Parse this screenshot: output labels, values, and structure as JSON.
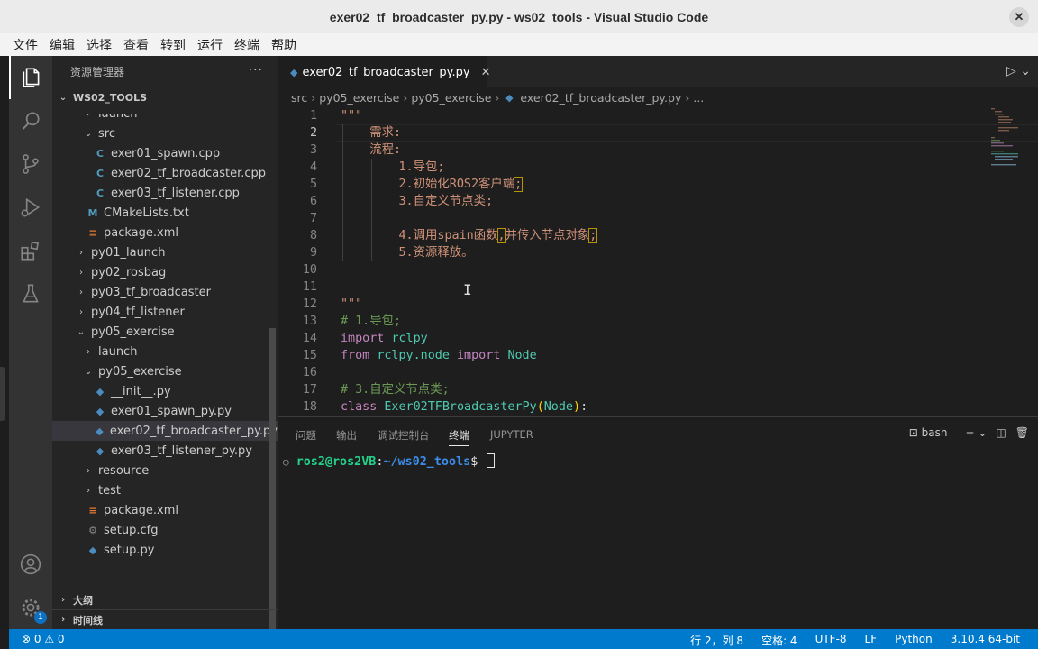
{
  "window": {
    "title": "exer02_tf_broadcaster_py.py - ws02_tools - Visual Studio Code",
    "close_glyph": "✕"
  },
  "menu": [
    "文件",
    "编辑",
    "选择",
    "查看",
    "转到",
    "运行",
    "终端",
    "帮助"
  ],
  "activity_bar": {
    "icons": [
      "files-icon",
      "search-icon",
      "source-control-icon",
      "run-debug-icon",
      "extensions-icon",
      "testing-icon",
      "account-icon",
      "settings-gear-icon"
    ],
    "settings_badge": "1"
  },
  "explorer": {
    "title": "资源管理器",
    "more": "···",
    "root": "WS02_TOOLS",
    "items": [
      {
        "label": "launch",
        "type": "folder",
        "expanded": false,
        "depth": 1
      },
      {
        "label": "src",
        "type": "folder",
        "expanded": true,
        "depth": 1
      },
      {
        "label": "exer01_spawn.cpp",
        "type": "cpp",
        "depth": 2
      },
      {
        "label": "exer02_tf_broadcaster.cpp",
        "type": "cpp",
        "depth": 2
      },
      {
        "label": "exer03_tf_listener.cpp",
        "type": "cpp",
        "depth": 2
      },
      {
        "label": "CMakeLists.txt",
        "type": "cmake",
        "depth": 1
      },
      {
        "label": "package.xml",
        "type": "xml",
        "depth": 1
      },
      {
        "label": "py01_launch",
        "type": "folder",
        "expanded": false,
        "depth": 0
      },
      {
        "label": "py02_rosbag",
        "type": "folder",
        "expanded": false,
        "depth": 0
      },
      {
        "label": "py03_tf_broadcaster",
        "type": "folder",
        "expanded": false,
        "depth": 0
      },
      {
        "label": "py04_tf_listener",
        "type": "folder",
        "expanded": false,
        "depth": 0
      },
      {
        "label": "py05_exercise",
        "type": "folder",
        "expanded": true,
        "depth": 0
      },
      {
        "label": "launch",
        "type": "folder",
        "expanded": false,
        "depth": 1
      },
      {
        "label": "py05_exercise",
        "type": "folder",
        "expanded": true,
        "depth": 1
      },
      {
        "label": "__init__.py",
        "type": "py",
        "depth": 2
      },
      {
        "label": "exer01_spawn_py.py",
        "type": "py",
        "depth": 2
      },
      {
        "label": "exer02_tf_broadcaster_py.py",
        "type": "py",
        "depth": 2,
        "selected": true
      },
      {
        "label": "exer03_tf_listener_py.py",
        "type": "py",
        "depth": 2
      },
      {
        "label": "resource",
        "type": "folder",
        "expanded": false,
        "depth": 1
      },
      {
        "label": "test",
        "type": "folder",
        "expanded": false,
        "depth": 1
      },
      {
        "label": "package.xml",
        "type": "xml",
        "depth": 1
      },
      {
        "label": "setup.cfg",
        "type": "cfg",
        "depth": 1
      },
      {
        "label": "setup.py",
        "type": "py",
        "depth": 1
      }
    ],
    "outline": "大纲",
    "timeline": "时间线"
  },
  "editor": {
    "tab": {
      "label": "exer02_tf_broadcaster_py.py",
      "close": "✕"
    },
    "breadcrumb": [
      "src",
      "py05_exercise",
      "py05_exercise",
      "exer02_tf_broadcaster_py.py",
      "..."
    ],
    "lines": [
      [
        {
          "t": "\"\"\"",
          "c": "s"
        }
      ],
      [
        {
          "t": "    需求:",
          "c": "s"
        }
      ],
      [
        {
          "t": "    流程:",
          "c": "s"
        }
      ],
      [
        {
          "t": "        1.导包;",
          "c": "s"
        }
      ],
      [
        {
          "t": "        2.初始化ROS2客户端",
          "c": "s"
        },
        {
          "t": ";",
          "c": "s hl"
        }
      ],
      [
        {
          "t": "        3.自定义节点类;",
          "c": "s"
        }
      ],
      [
        {
          "t": "",
          "c": "s"
        }
      ],
      [
        {
          "t": "        4.调用spain函数",
          "c": "s"
        },
        {
          "t": ",",
          "c": "s hl"
        },
        {
          "t": "并传入节点对象",
          "c": "s"
        },
        {
          "t": ";",
          "c": "s hl"
        }
      ],
      [
        {
          "t": "        5.资源释放。",
          "c": "s"
        }
      ],
      [
        {
          "t": "",
          "c": "s"
        }
      ],
      [
        {
          "t": "",
          "c": "s"
        }
      ],
      [
        {
          "t": "\"\"\"",
          "c": "s"
        }
      ],
      [
        {
          "t": "# 1.导包;",
          "c": "c"
        }
      ],
      [
        {
          "t": "import",
          "c": "k"
        },
        {
          "t": " ",
          "c": ""
        },
        {
          "t": "rclpy",
          "c": "t"
        }
      ],
      [
        {
          "t": "from",
          "c": "k"
        },
        {
          "t": " ",
          "c": ""
        },
        {
          "t": "rclpy.node",
          "c": "t"
        },
        {
          "t": " ",
          "c": ""
        },
        {
          "t": "import",
          "c": "k"
        },
        {
          "t": " ",
          "c": ""
        },
        {
          "t": "Node",
          "c": "t"
        }
      ],
      [
        {
          "t": "",
          "c": ""
        }
      ],
      [
        {
          "t": "# 3.自定义节点类;",
          "c": "c"
        }
      ],
      [
        {
          "t": "class",
          "c": "k"
        },
        {
          "t": " ",
          "c": ""
        },
        {
          "t": "Exer02TFBroadcasterPy",
          "c": "t"
        },
        {
          "t": "(",
          "c": "p"
        },
        {
          "t": "Node",
          "c": "t"
        },
        {
          "t": ")",
          "c": "p"
        },
        {
          "t": ":",
          "c": ""
        }
      ]
    ]
  },
  "panel": {
    "tabs": [
      "问题",
      "输出",
      "调试控制台",
      "终端",
      "JUPYTER"
    ],
    "active_tab": "终端",
    "shell": "bash",
    "terminal": {
      "dot": "○",
      "user_host": "ros2@ros2VB",
      "colon": ":",
      "path": "~/ws02_tools",
      "dollar": "$"
    }
  },
  "status": {
    "errors": "⊗ 0",
    "warnings": "⚠ 0",
    "cursor": "行 2，列 8",
    "indent": "空格: 4",
    "encoding": "UTF-8",
    "eol": "LF",
    "language": "Python",
    "interpreter": "3.10.4 64-bit"
  }
}
